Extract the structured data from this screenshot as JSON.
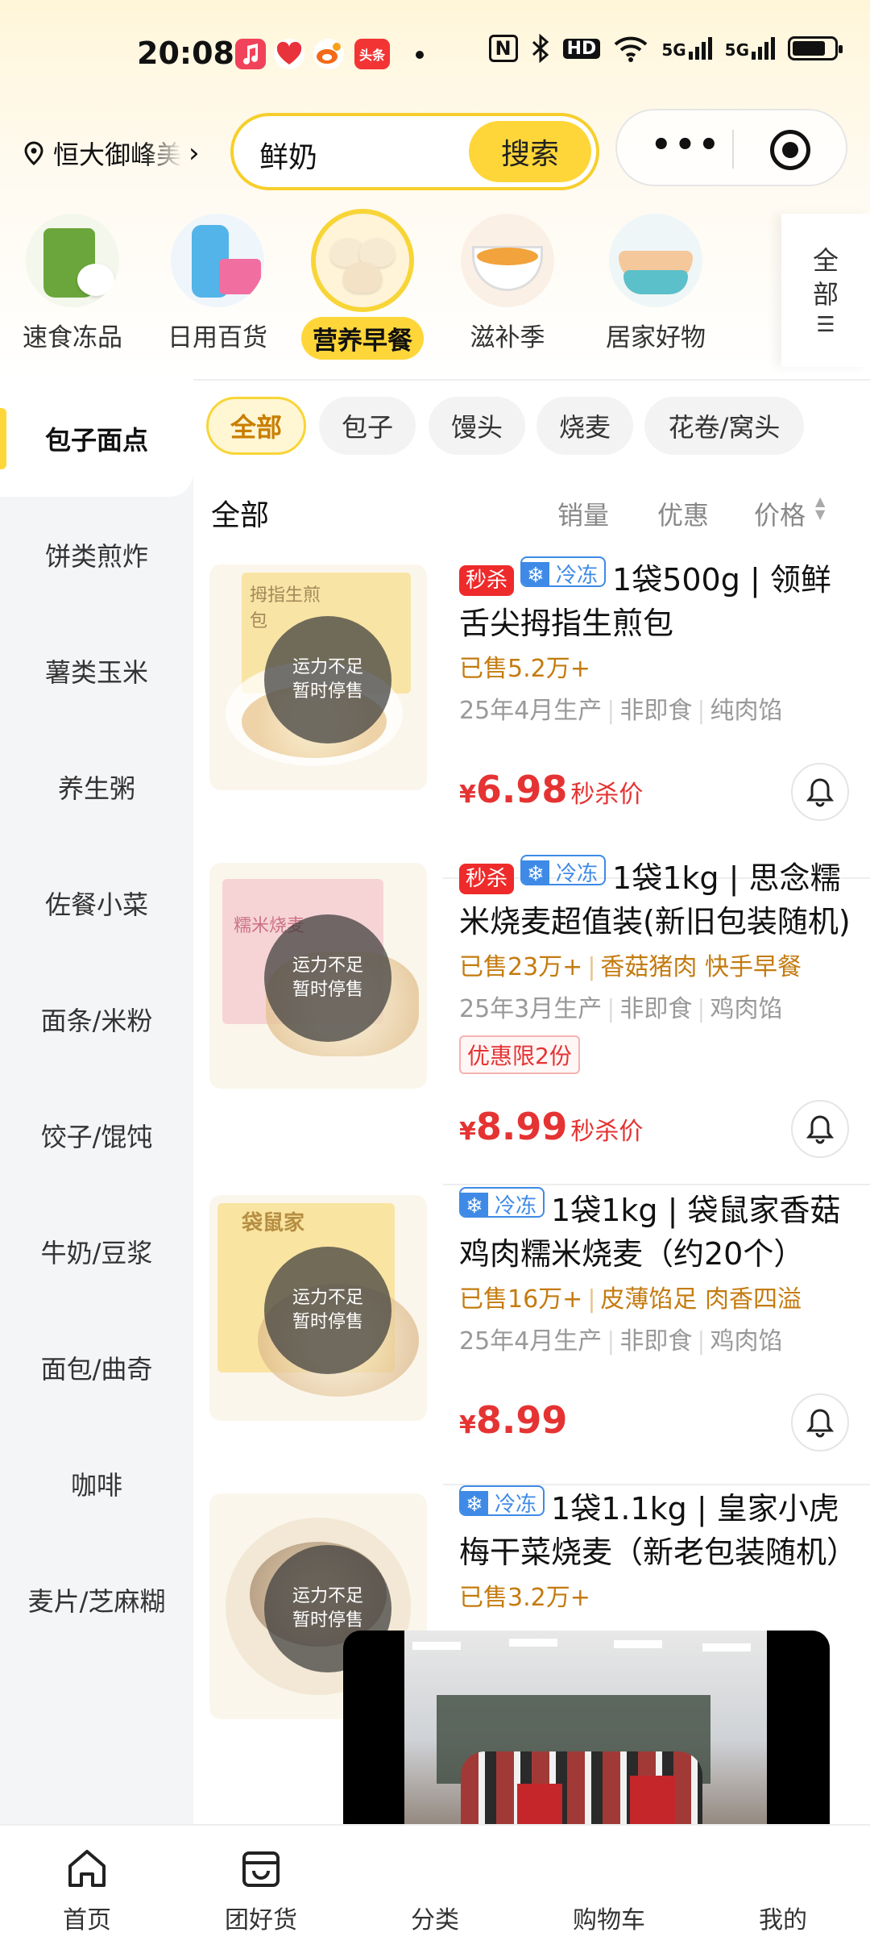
{
  "status_bar": {
    "time": "20:08",
    "network_5g_1": "5G",
    "network_5g_2": "5G",
    "hd": "HD",
    "nfc": "N",
    "app_badge_toutiao": "头条",
    "icons": [
      "music-app-icon",
      "heart-app-icon",
      "weibo-app-icon",
      "toutiao-app-icon",
      "dot-icon",
      "nfc-icon",
      "bluetooth-icon",
      "hd-icon",
      "wifi-icon",
      "signal-icon",
      "signal-icon",
      "battery-icon"
    ]
  },
  "header": {
    "location": "恒大御峰美",
    "search_value": "鲜奶",
    "search_button": "搜索"
  },
  "categories": [
    {
      "label": "速食冻品"
    },
    {
      "label": "日用百货"
    },
    {
      "label": "营养早餐",
      "active": true
    },
    {
      "label": "滋补季"
    },
    {
      "label": "居家好物"
    }
  ],
  "all_categories_label": "全部",
  "sidebar": [
    {
      "label": "包子面点",
      "active": true
    },
    {
      "label": "饼类煎炸"
    },
    {
      "label": "薯类玉米"
    },
    {
      "label": "养生粥"
    },
    {
      "label": "佐餐小菜"
    },
    {
      "label": "面条/米粉"
    },
    {
      "label": "饺子/馄饨"
    },
    {
      "label": "牛奶/豆浆"
    },
    {
      "label": "面包/曲奇"
    },
    {
      "label": "咖啡"
    },
    {
      "label": "麦片/芝麻糊"
    }
  ],
  "chips": [
    "全部",
    "包子",
    "馒头",
    "烧麦",
    "花卷/窝头"
  ],
  "sort": {
    "title": "全部",
    "options": [
      "销量",
      "优惠",
      "价格"
    ]
  },
  "products": [
    {
      "tag_seckill": "秒杀",
      "tag_frozen": "冷冻",
      "title": "1袋500g | 领鲜舌尖拇指生煎包",
      "sold": "已售5.2万+",
      "meta": [
        "25年4月生产",
        "非即食",
        "纯肉馅"
      ],
      "overlay": [
        "运力不足",
        "暂时停售"
      ],
      "price_symbol": "¥",
      "price": "6.98",
      "price_label": "秒杀价",
      "image_text": "拇指生煎包"
    },
    {
      "tag_seckill": "秒杀",
      "tag_frozen": "冷冻",
      "title": "1袋1kg | 思念糯米烧麦超值装(新旧包装随机)",
      "sold": "已售23万+",
      "sold_extra": "香菇猪肉 快手早餐",
      "meta": [
        "25年3月生产",
        "非即食",
        "鸡肉馅"
      ],
      "coupon": "优惠限2份",
      "overlay": [
        "运力不足",
        "暂时停售"
      ],
      "price_symbol": "¥",
      "price": "8.99",
      "price_label": "秒杀价",
      "image_text": "糯米烧麦"
    },
    {
      "tag_frozen": "冷冻",
      "title": "1袋1kg | 袋鼠家香菇鸡肉糯米烧麦（约20个）",
      "sold": "已售16万+",
      "sold_extra": "皮薄馅足 肉香四溢",
      "meta": [
        "25年4月生产",
        "非即食",
        "鸡肉馅"
      ],
      "overlay": [
        "运力不足",
        "暂时停售"
      ],
      "price_symbol": "¥",
      "price": "8.99",
      "image_text": "袋鼠家"
    },
    {
      "tag_frozen": "冷冻",
      "title": "1袋1.1kg | 皇家小虎梅干菜烧麦（新老包装随机）",
      "sold": "已售3.2万+",
      "overlay": [
        "运力不足",
        "暂时停售"
      ]
    }
  ],
  "bottom_nav": [
    {
      "label": "首页",
      "icon": "home-icon"
    },
    {
      "label": "团好货",
      "icon": "bag-icon"
    },
    {
      "label": "分类",
      "icon": "category-icon"
    },
    {
      "label": "购物车",
      "icon": "cart-icon"
    },
    {
      "label": "我的",
      "icon": "profile-icon"
    }
  ],
  "colors": {
    "accent": "#ffd639",
    "price": "#e53333",
    "frozen": "#3e8ae6",
    "sold": "#c47b10"
  }
}
